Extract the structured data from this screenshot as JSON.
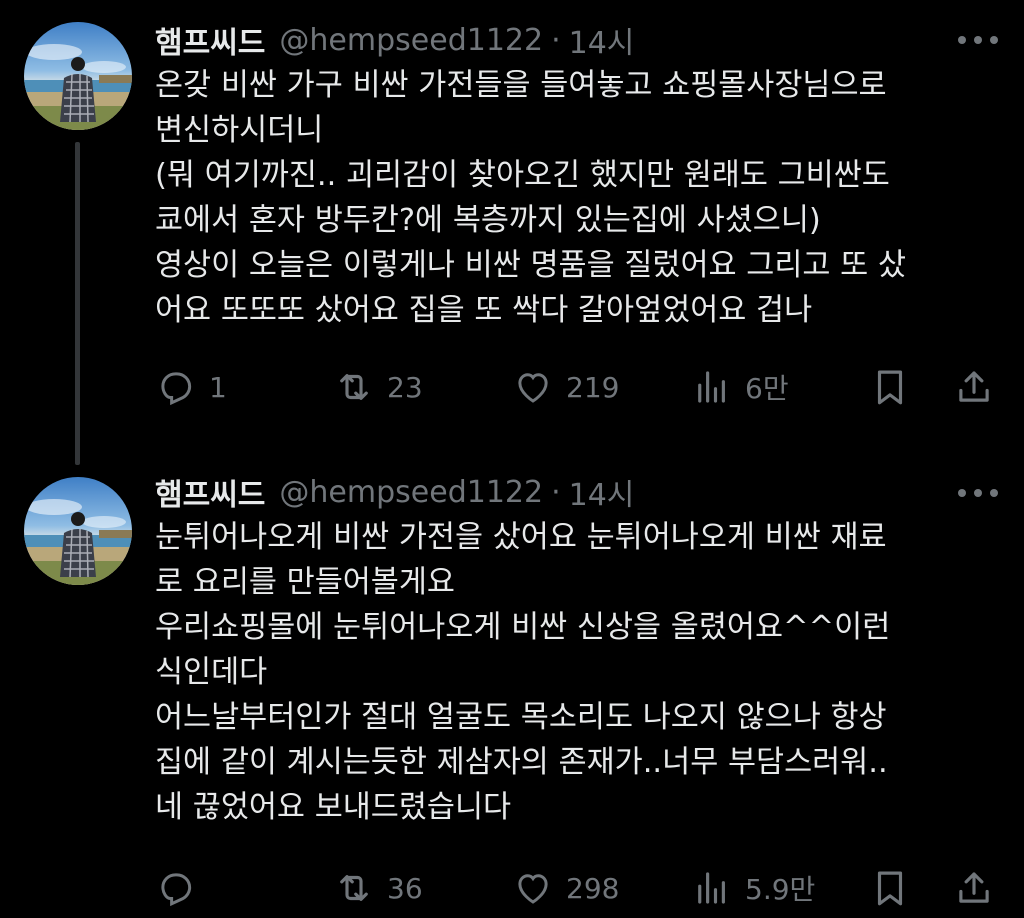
{
  "tweets": [
    {
      "name": "햄프씨드",
      "handle": "@hempseed1122",
      "separator": "·",
      "time": "14시",
      "lines": [
        "온갖 비싼 가구 비싼 가전들을 들여놓고 쇼핑몰사장님으로",
        "변신하시더니",
        "(뭐 여기까진.. 괴리감이 찾아오긴 했지만 원래도 그비싼도",
        "쿄에서 혼자 방두칸?에 복층까지 있는집에 사셨으니)",
        "영상이 오늘은 이렇게나 비싼 명품을 질렀어요 그리고 또 샀",
        "어요 또또또 샀어요 집을 또 싹다 갈아엎었어요 겁나"
      ],
      "replies": "1",
      "reposts": "23",
      "likes": "219",
      "views": "6만"
    },
    {
      "name": "햄프씨드",
      "handle": "@hempseed1122",
      "separator": "·",
      "time": "14시",
      "lines": [
        "눈튀어나오게 비싼 가전을 샀어요 눈튀어나오게 비싼 재료",
        "로 요리를 만들어볼게요",
        "우리쇼핑몰에 눈튀어나오게 비싼 신상을 올렸어요^^이런",
        "식인데다",
        "어느날부터인가 절대 얼굴도 목소리도 나오지 않으나 항상",
        "집에 같이 계시는듯한 제삼자의 존재가..너무 부담스러워..",
        "네 끊었어요 보내드렸습니다"
      ],
      "replies": "",
      "reposts": "36",
      "likes": "298",
      "views": "5.9만"
    }
  ],
  "colors": {
    "background": "#000000",
    "text": "#e7e9ea",
    "muted": "#71767b",
    "thread": "#333639"
  },
  "icons": [
    "reply-icon",
    "repost-icon",
    "like-icon",
    "views-icon",
    "bookmark-icon",
    "share-icon",
    "more-icon"
  ]
}
